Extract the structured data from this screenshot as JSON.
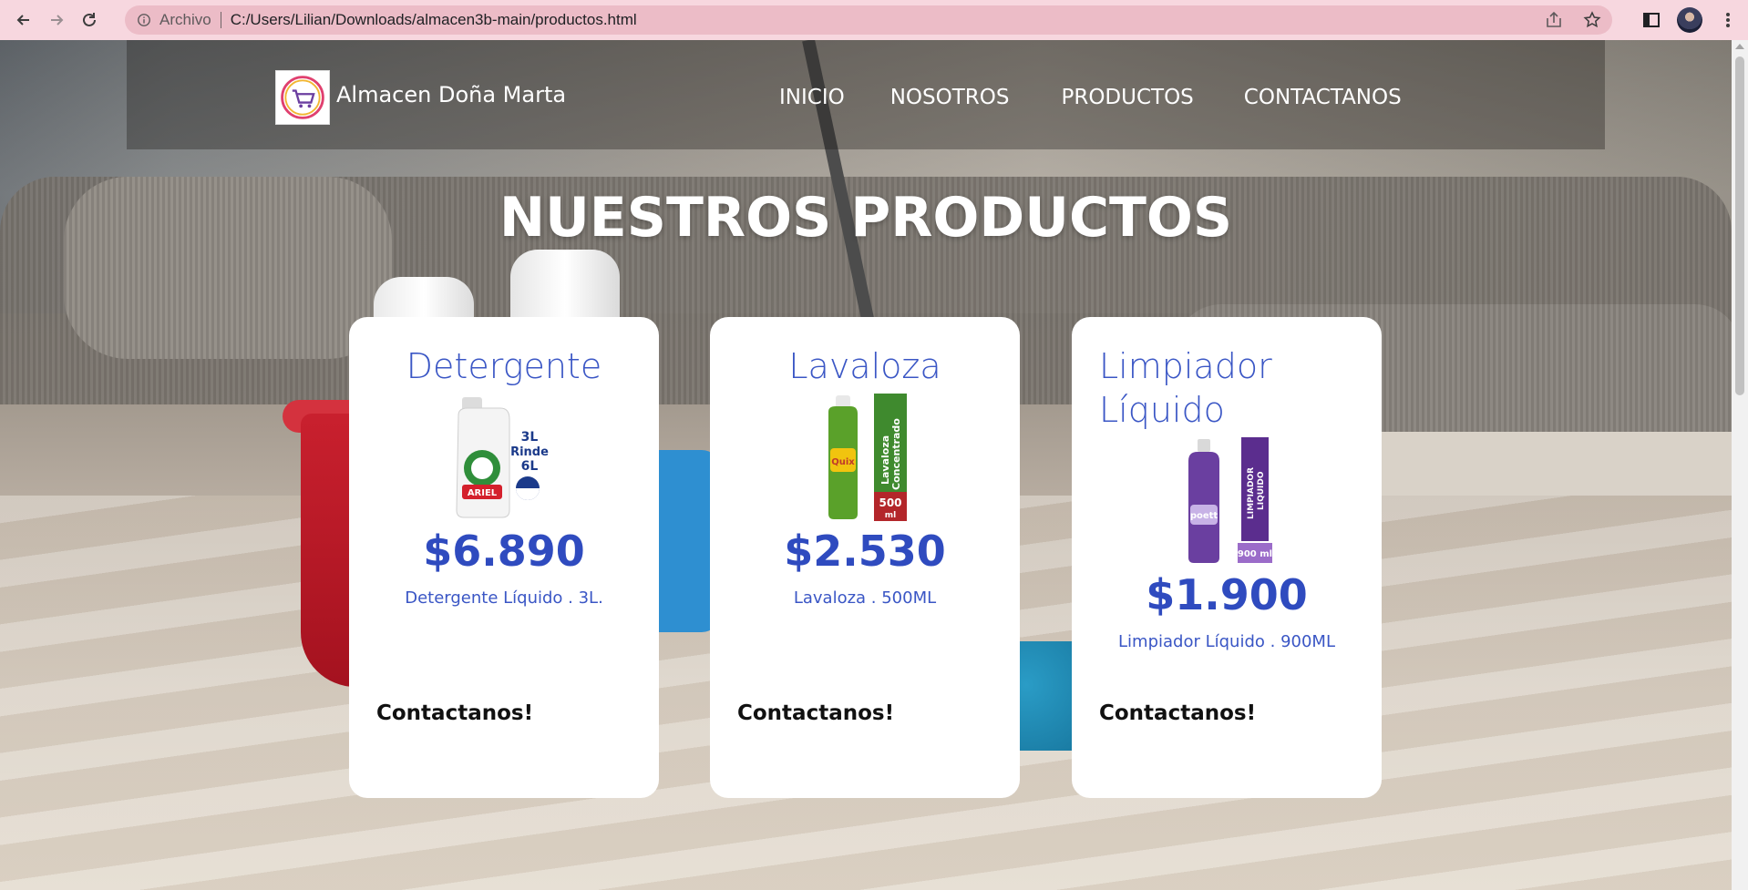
{
  "browser": {
    "scheme_label": "Archivo",
    "url": "C:/Users/Lilian/Downloads/almacen3b-main/productos.html"
  },
  "header": {
    "brand": "Almacen Doña Marta",
    "nav": [
      {
        "label": "INICIO"
      },
      {
        "label": "NOSOTROS"
      },
      {
        "label": "PRODUCTOS"
      },
      {
        "label": "CONTACTANOS"
      }
    ]
  },
  "main": {
    "title": "NUESTROS PRODUCTOS",
    "products": [
      {
        "name": "Detergente",
        "price": "$6.890",
        "description": "Detergente Líquido . 3L.",
        "cta": "Contactanos!",
        "image_label_lines": [
          "3L",
          "Rinde",
          "6L"
        ],
        "image_brand": "ARIEL"
      },
      {
        "name": "Lavaloza",
        "price": "$2.530",
        "description": "Lavaloza . 500ML",
        "cta": "Contactanos!",
        "image_label_lines": [
          "Lavaloza",
          "Concentrado"
        ],
        "image_volume": "500",
        "image_unit": "ml",
        "image_brand": "Quix"
      },
      {
        "name": "Limpiador Líquido",
        "price": "$1.900",
        "description": "Limpiador Líquido . 900ML",
        "cta": "Contactanos!",
        "image_label_lines": [
          "LIMPIADOR",
          "LIQUIDO"
        ],
        "image_volume": "900 ml",
        "image_brand": "poett"
      }
    ]
  },
  "colors": {
    "chrome_bg": "#f7d7df",
    "omnibox_bg": "#ecbcc7",
    "product_name": "#3a56c5",
    "price": "#2f4bbf"
  }
}
